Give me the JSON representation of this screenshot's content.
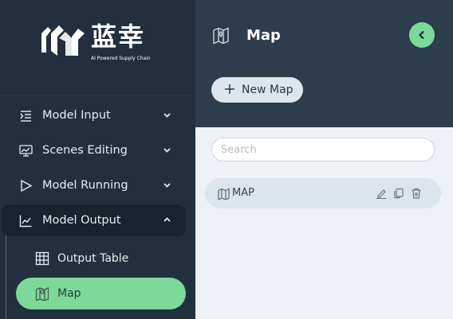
{
  "logo": {
    "name_cn": "蓝幸",
    "tagline": "AI Powered Supply Chain"
  },
  "sidebar": {
    "items": [
      {
        "label": "Model Input",
        "icon": "list-indent-icon",
        "expanded": false
      },
      {
        "label": "Scenes Editing",
        "icon": "monitor-chart-icon",
        "expanded": false
      },
      {
        "label": "Model Running",
        "icon": "play-icon",
        "expanded": false
      },
      {
        "label": "Model Output",
        "icon": "line-chart-icon",
        "expanded": true
      }
    ],
    "sub_items": [
      {
        "label": "Output Table",
        "icon": "table-icon",
        "selected": false
      },
      {
        "label": "Map",
        "icon": "map-icon",
        "selected": true
      }
    ]
  },
  "header": {
    "title": "Map",
    "title_icon": "map-icon",
    "collapse_icon": "chevron-left-icon",
    "new_button_label": "New Map"
  },
  "content": {
    "search_placeholder": "Search",
    "search_value": "",
    "maps": [
      {
        "label": "MAP",
        "icon": "map-icon",
        "actions": [
          "edit-icon",
          "copy-icon",
          "delete-icon"
        ]
      }
    ]
  },
  "colors": {
    "sidebar_bg": "#22303d",
    "header_bg": "#2c3d4e",
    "accent_green": "#7dd99a",
    "content_bg": "#eef2f6",
    "row_bg": "#dce4ec"
  }
}
